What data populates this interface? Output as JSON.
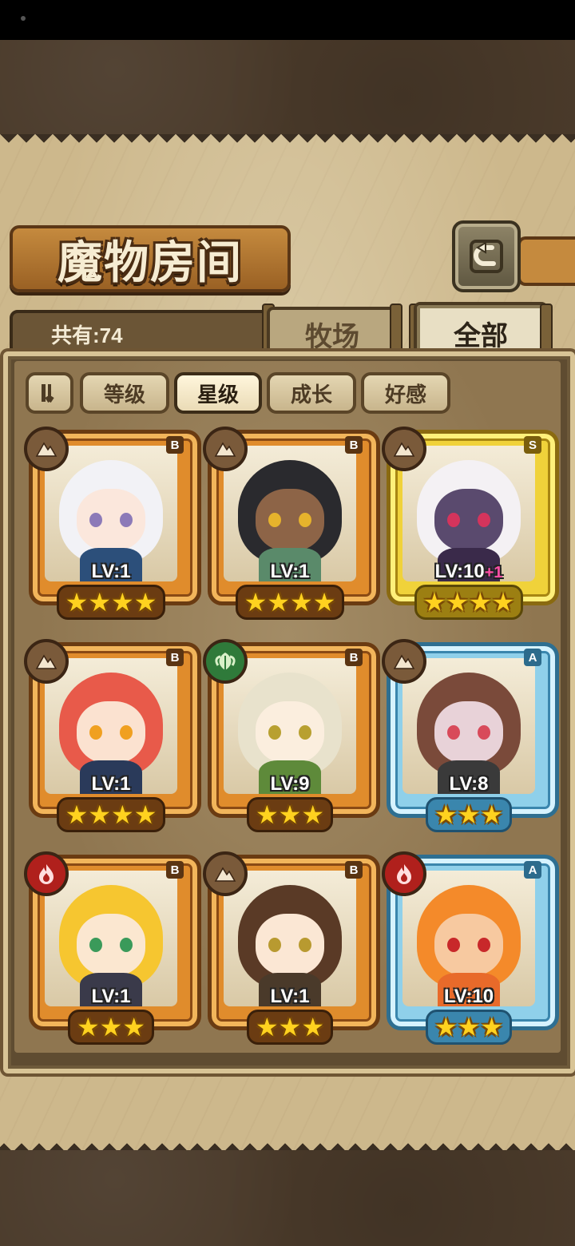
{
  "title": "魔物房间",
  "count_label": "共有:74",
  "tabs": {
    "ranch": "牧场",
    "all": "全部"
  },
  "filters": [
    "等级",
    "星级",
    "成长",
    "好感"
  ],
  "selected_filter": "星级",
  "cards": [
    {
      "level": "LV:1",
      "plus": "",
      "rank": "B",
      "element": "earth",
      "stars": 4,
      "frame": "orange",
      "hair": "#f2f2f6",
      "skin": "#fbe7dc",
      "eye": "#8c7ab8",
      "outfit": "#2c4f7a"
    },
    {
      "level": "LV:1",
      "plus": "",
      "rank": "B",
      "element": "earth",
      "stars": 4,
      "frame": "orange",
      "hair": "#2a2a2e",
      "skin": "#8d6447",
      "eye": "#e6b32c",
      "outfit": "#5a8a6a"
    },
    {
      "level": "LV:10",
      "plus": "+1",
      "rank": "S",
      "element": "earth",
      "stars": 4,
      "frame": "gold",
      "hair": "#f4f1f4",
      "skin": "#5a4a6e",
      "eye": "#d4345c",
      "outfit": "#3a2a4a"
    },
    {
      "level": "LV:1",
      "plus": "",
      "rank": "B",
      "element": "earth",
      "stars": 4,
      "frame": "orange",
      "hair": "#e85a4a",
      "skin": "#fbe2d0",
      "eye": "#f0a020",
      "outfit": "#2a3a5a"
    },
    {
      "level": "LV:9",
      "plus": "",
      "rank": "B",
      "element": "leaf",
      "stars": 3,
      "frame": "orange",
      "hair": "#e8e2cc",
      "skin": "#fbeede",
      "eye": "#b8a030",
      "outfit": "#5e8a3a"
    },
    {
      "level": "LV:8",
      "plus": "",
      "rank": "A",
      "element": "earth",
      "stars": 3,
      "frame": "blue",
      "hair": "#7a4a3a",
      "skin": "#e8d2d8",
      "eye": "#d84a5a",
      "outfit": "#3a3a3a"
    },
    {
      "level": "LV:1",
      "plus": "",
      "rank": "B",
      "element": "fire",
      "stars": 3,
      "frame": "orange",
      "hair": "#f6c630",
      "skin": "#fbe7d0",
      "eye": "#3a9a5a",
      "outfit": "#3a3a4a"
    },
    {
      "level": "LV:1",
      "plus": "",
      "rank": "B",
      "element": "earth",
      "stars": 3,
      "frame": "orange",
      "hair": "#5a3a26",
      "skin": "#fbe7d4",
      "eye": "#b89a30",
      "outfit": "#4a3a2a"
    },
    {
      "level": "LV:10",
      "plus": "",
      "rank": "A",
      "element": "fire",
      "stars": 3,
      "frame": "blue",
      "hair": "#f48a2a",
      "skin": "#f7c9a0",
      "eye": "#c8282a",
      "outfit": "#e86a2a"
    }
  ],
  "icons": {
    "back": "back-arrow-icon",
    "sort": "sort-toggle-icon",
    "earth": "mountain-icon",
    "leaf": "leaf-icon",
    "fire": "flame-icon",
    "star": "star-icon"
  }
}
